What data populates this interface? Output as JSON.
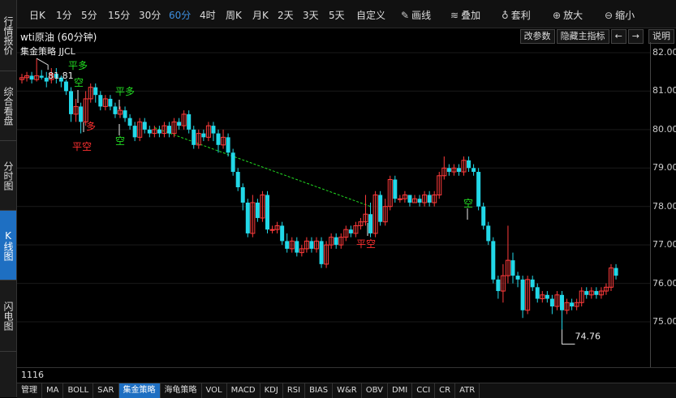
{
  "left_tabs": [
    {
      "label": "行情报价",
      "active": false
    },
    {
      "label": "综合看盘",
      "active": false
    },
    {
      "label": "分时图",
      "active": false
    },
    {
      "label": "K线图",
      "active": true
    },
    {
      "label": "闪电图",
      "active": false
    }
  ],
  "toolbar": {
    "periods": [
      "日K",
      "1分",
      "5分",
      "15分",
      "30分",
      "60分",
      "4时",
      "周K",
      "月K",
      "2天",
      "3天",
      "5天",
      "自定义"
    ],
    "active_period": "60分",
    "draw_line": "画线",
    "overlay": "叠加",
    "arbitrage": "套利",
    "zoom_in": "放大",
    "zoom_out": "缩小"
  },
  "chart": {
    "title": "wti原油 (60分钟)",
    "indicator": "集金策略 JJCL",
    "buttons": {
      "params": "改参数",
      "hide": "隐藏主指标",
      "prev": "←",
      "next": "→",
      "help": "说明"
    },
    "price_labels": [
      "82.00",
      "81.00",
      "80.00",
      "79.00",
      "78.00",
      "77.00",
      "76.00",
      "75.00"
    ],
    "high_label": "81.81",
    "low_label": "74.76",
    "signals": [
      {
        "text": "平多",
        "color": "#22dd22"
      },
      {
        "text": "空",
        "color": "#22dd22"
      },
      {
        "text": "多",
        "color": "#ff3030"
      },
      {
        "text": "平空",
        "color": "#ff3030"
      },
      {
        "text": "平多",
        "color": "#22dd22"
      },
      {
        "text": "空",
        "color": "#22dd22"
      },
      {
        "text": "平空",
        "color": "#ff3030"
      },
      {
        "text": "空",
        "color": "#22dd22"
      }
    ],
    "up_color": "#ff3b3b",
    "down_color": "#22d8e8"
  },
  "status": {
    "count": "1116"
  },
  "bottom_tabs": [
    "管理",
    "MA",
    "BOLL",
    "SAR",
    "集金策略",
    "海龟策略",
    "VOL",
    "MACD",
    "KDJ",
    "RSI",
    "BIAS",
    "W&R",
    "OBV",
    "DMI",
    "CCI",
    "CR",
    "ATR"
  ],
  "active_bottom_tab": "集金策略",
  "candles": [
    [
      81.3,
      81.35,
      81.2,
      81.45
    ],
    [
      81.35,
      81.4,
      81.25,
      81.5
    ],
    [
      81.4,
      81.3,
      81.2,
      81.5
    ],
    [
      81.3,
      81.4,
      81.25,
      81.85
    ],
    [
      81.4,
      81.35,
      81.3,
      81.55
    ],
    [
      81.35,
      81.25,
      81.1,
      81.5
    ],
    [
      81.3,
      81.45,
      81.2,
      81.6
    ],
    [
      81.45,
      81.35,
      81.2,
      81.6
    ],
    [
      81.35,
      81.25,
      81.1,
      81.4
    ],
    [
      81.25,
      81.0,
      80.9,
      81.3
    ],
    [
      81.0,
      80.4,
      80.2,
      81.1
    ],
    [
      80.4,
      80.6,
      80.2,
      80.8
    ],
    [
      80.6,
      80.2,
      79.9,
      80.7
    ],
    [
      80.2,
      80.8,
      80.1,
      81.0
    ],
    [
      80.8,
      81.1,
      80.7,
      81.2
    ],
    [
      81.1,
      80.9,
      80.7,
      81.2
    ],
    [
      80.9,
      80.6,
      80.5,
      81.0
    ],
    [
      80.6,
      80.8,
      80.5,
      80.9
    ],
    [
      80.8,
      80.6,
      80.5,
      80.9
    ],
    [
      80.6,
      80.4,
      80.3,
      80.7
    ],
    [
      80.4,
      80.5,
      80.3,
      80.6
    ],
    [
      80.5,
      80.3,
      80.2,
      80.6
    ],
    [
      80.3,
      80.1,
      80.0,
      80.4
    ],
    [
      80.1,
      79.8,
      79.7,
      80.2
    ],
    [
      79.8,
      80.2,
      79.7,
      80.3
    ],
    [
      80.2,
      80.0,
      79.9,
      80.3
    ],
    [
      80.0,
      79.9,
      79.8,
      80.1
    ],
    [
      79.9,
      80.0,
      79.8,
      80.1
    ],
    [
      80.0,
      79.9,
      79.8,
      80.1
    ],
    [
      79.9,
      80.1,
      79.8,
      80.2
    ],
    [
      80.1,
      79.9,
      79.8,
      80.2
    ],
    [
      79.9,
      80.2,
      79.8,
      80.3
    ],
    [
      80.2,
      80.1,
      80.0,
      80.3
    ],
    [
      80.1,
      80.4,
      80.0,
      80.5
    ],
    [
      80.4,
      80.0,
      79.9,
      80.5
    ],
    [
      80.0,
      79.6,
      79.5,
      80.1
    ],
    [
      79.6,
      79.9,
      79.5,
      80.0
    ],
    [
      79.9,
      79.8,
      79.7,
      80.0
    ],
    [
      79.8,
      80.1,
      79.7,
      80.2
    ],
    [
      80.1,
      79.9,
      79.7,
      80.2
    ],
    [
      79.9,
      79.6,
      79.4,
      80.0
    ],
    [
      79.6,
      79.8,
      79.5,
      80.0
    ],
    [
      79.8,
      79.4,
      79.3,
      79.9
    ],
    [
      79.4,
      78.9,
      78.8,
      79.5
    ],
    [
      78.9,
      78.5,
      78.4,
      79.0
    ],
    [
      78.5,
      78.1,
      77.9,
      78.6
    ],
    [
      78.1,
      77.3,
      77.2,
      78.2
    ],
    [
      77.3,
      78.1,
      77.2,
      78.3
    ],
    [
      78.1,
      77.7,
      77.6,
      78.2
    ],
    [
      77.7,
      78.3,
      77.6,
      78.4
    ],
    [
      78.3,
      77.4,
      77.3,
      78.4
    ],
    [
      77.4,
      77.4,
      77.3,
      77.5
    ],
    [
      77.4,
      77.5,
      77.3,
      77.6
    ],
    [
      77.5,
      77.1,
      77.0,
      77.6
    ],
    [
      77.1,
      76.9,
      76.8,
      77.3
    ],
    [
      76.9,
      77.1,
      76.8,
      77.2
    ],
    [
      77.1,
      76.8,
      76.7,
      77.2
    ],
    [
      76.8,
      76.9,
      76.7,
      77.0
    ],
    [
      76.9,
      77.1,
      76.8,
      77.2
    ],
    [
      77.1,
      76.9,
      76.8,
      77.2
    ],
    [
      76.9,
      77.1,
      76.8,
      77.2
    ],
    [
      77.1,
      76.5,
      76.4,
      77.2
    ],
    [
      76.5,
      77.0,
      76.4,
      77.1
    ],
    [
      77.0,
      77.2,
      76.9,
      77.3
    ],
    [
      77.2,
      77.0,
      76.9,
      77.3
    ],
    [
      77.0,
      77.2,
      76.9,
      77.3
    ],
    [
      77.2,
      77.4,
      77.1,
      77.5
    ],
    [
      77.4,
      77.3,
      77.2,
      77.5
    ],
    [
      77.3,
      77.5,
      77.2,
      77.6
    ],
    [
      77.5,
      77.6,
      77.4,
      77.7
    ],
    [
      77.6,
      77.8,
      77.5,
      78.3
    ],
    [
      77.8,
      77.3,
      77.2,
      78.1
    ],
    [
      77.3,
      78.3,
      77.2,
      78.4
    ],
    [
      78.3,
      77.6,
      77.5,
      78.4
    ],
    [
      77.6,
      78.0,
      77.5,
      78.2
    ],
    [
      78.0,
      78.7,
      77.9,
      78.8
    ],
    [
      78.7,
      78.2,
      78.1,
      78.8
    ],
    [
      78.2,
      78.2,
      78.1,
      78.3
    ],
    [
      78.2,
      78.3,
      78.1,
      78.4
    ],
    [
      78.3,
      78.1,
      78.0,
      78.3
    ],
    [
      78.1,
      78.2,
      78.1,
      78.3
    ],
    [
      78.2,
      78.1,
      78.0,
      78.3
    ],
    [
      78.1,
      78.3,
      78.0,
      78.4
    ],
    [
      78.3,
      78.1,
      78.0,
      78.4
    ],
    [
      78.1,
      78.3,
      78.0,
      78.4
    ],
    [
      78.3,
      78.8,
      78.2,
      78.9
    ],
    [
      78.8,
      79.0,
      78.7,
      79.3
    ],
    [
      79.0,
      78.9,
      78.8,
      79.1
    ],
    [
      78.9,
      79.0,
      78.8,
      79.1
    ],
    [
      79.0,
      78.9,
      78.8,
      79.1
    ],
    [
      78.9,
      79.2,
      78.8,
      79.3
    ],
    [
      79.2,
      79.0,
      78.9,
      79.3
    ],
    [
      79.0,
      78.9,
      78.8,
      79.1
    ],
    [
      78.9,
      78.0,
      77.9,
      79.0
    ],
    [
      78.0,
      77.5,
      77.4,
      78.1
    ],
    [
      77.5,
      77.1,
      77.0,
      77.6
    ],
    [
      77.1,
      76.1,
      76.0,
      77.2
    ],
    [
      76.1,
      75.8,
      75.6,
      76.2
    ],
    [
      75.8,
      76.2,
      75.5,
      76.5
    ],
    [
      76.2,
      76.6,
      76.0,
      77.5
    ],
    [
      76.6,
      76.2,
      76.0,
      76.8
    ],
    [
      76.2,
      76.1,
      75.9,
      76.3
    ],
    [
      76.1,
      75.3,
      75.1,
      76.2
    ],
    [
      75.3,
      76.1,
      75.2,
      76.2
    ],
    [
      76.1,
      75.9,
      75.8,
      76.2
    ],
    [
      75.9,
      75.6,
      75.5,
      76.0
    ],
    [
      75.6,
      75.7,
      75.5,
      75.8
    ],
    [
      75.7,
      75.6,
      75.5,
      75.8
    ],
    [
      75.6,
      75.4,
      75.2,
      75.7
    ],
    [
      75.4,
      75.7,
      75.3,
      75.8
    ],
    [
      75.7,
      75.3,
      74.8,
      75.8
    ],
    [
      75.3,
      75.5,
      75.2,
      75.6
    ],
    [
      75.5,
      75.4,
      75.3,
      75.6
    ],
    [
      75.4,
      75.5,
      75.3,
      75.6
    ],
    [
      75.5,
      75.8,
      75.4,
      75.9
    ],
    [
      75.8,
      75.7,
      75.6,
      75.9
    ],
    [
      75.7,
      75.8,
      75.6,
      75.9
    ],
    [
      75.8,
      75.7,
      75.6,
      75.9
    ],
    [
      75.7,
      75.8,
      75.6,
      75.9
    ],
    [
      75.8,
      75.9,
      75.7,
      76.0
    ],
    [
      75.9,
      76.4,
      75.8,
      76.5
    ],
    [
      76.4,
      76.2,
      76.1,
      76.5
    ]
  ]
}
